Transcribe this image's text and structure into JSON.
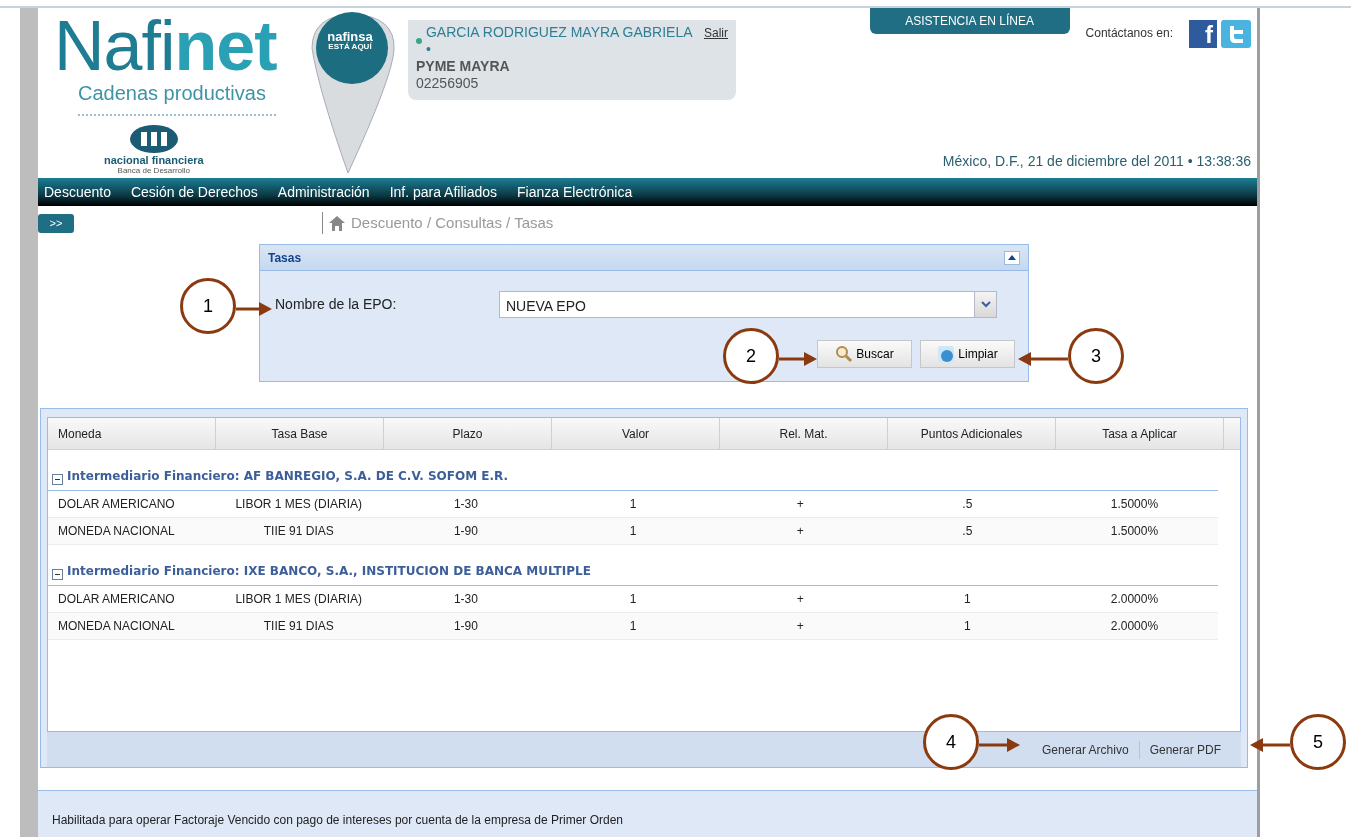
{
  "logo": {
    "wordmark": "Nafi**net**",
    "tagline": "Cadenas productivas",
    "institution": "nacional financiera",
    "institution_sub": "Banca de Desarrollo",
    "pin_line_1": "nafinsa",
    "pin_line_2": "ESTÁ AQUÍ"
  },
  "user": {
    "name": "GARCIA RODRIGUEZ MAYRA GABRIELA •",
    "logout": "Salir",
    "company": "PYME MAYRA",
    "number": "02256905"
  },
  "assist_button": "ASISTENCIA EN LÍNEA",
  "contact_label": "Contáctanos en:",
  "social": [
    {
      "kind": "facebook",
      "glyph": "f"
    },
    {
      "kind": "twitter"
    }
  ],
  "datetime": "México, D.F., 21 de diciembre del 2011 •  13:38:36",
  "menu": [
    "Descuento",
    "Cesión de Derechos",
    "Administración",
    "Inf. para Afiliados",
    "Fianza Electrónica"
  ],
  "sidebar_toggle": ">>",
  "breadcrumb": "Descuento / Consultas / Tasas",
  "filter_panel": {
    "title": "Tasas",
    "collapsed": false,
    "field_label": "Nombre de la EPO:",
    "field_value": "NUEVA EPO",
    "buttons": [
      {
        "kind": "search",
        "label": "Buscar"
      },
      {
        "kind": "clear",
        "label": "Limpiar"
      }
    ]
  },
  "grid": {
    "columns": [
      "Moneda",
      "Tasa Base",
      "Plazo",
      "Valor",
      "Rel. Mat.",
      "Puntos Adicionales",
      "Tasa a Aplicar"
    ],
    "groups": [
      {
        "title": "Intermediario Financiero: AF BANREGIO, S.A. DE C.V. SOFOM E.R.",
        "expanded": true,
        "rows": [
          [
            "DOLAR AMERICANO",
            "LIBOR 1 MES (DIARIA)",
            "1-30",
            "1",
            "+",
            ".5",
            "1.5000%"
          ],
          [
            "MONEDA NACIONAL",
            "TIIE 91 DIAS",
            "1-90",
            "1",
            "+",
            ".5",
            "1.5000%"
          ]
        ]
      },
      {
        "title": "Intermediario Financiero: IXE BANCO, S.A., INSTITUCION DE BANCA MULTIPLE",
        "expanded": true,
        "rows": [
          [
            "DOLAR AMERICANO",
            "LIBOR 1 MES (DIARIA)",
            "1-30",
            "1",
            "+",
            "1",
            "2.0000%"
          ],
          [
            "MONEDA NACIONAL",
            "TIIE 91 DIAS",
            "1-90",
            "1",
            "+",
            "1",
            "2.0000%"
          ]
        ]
      }
    ],
    "actions": [
      "Generar Archivo",
      "Generar PDF"
    ]
  },
  "note": "Habilitada para operar Factoraje Vencido con pago de intereses por cuenta de la empresa de Primer Orden",
  "callouts": [
    {
      "number": "1",
      "kind": "right"
    },
    {
      "number": "2",
      "kind": "right"
    },
    {
      "number": "3",
      "kind": "left"
    },
    {
      "number": "4",
      "kind": "right"
    },
    {
      "number": "5",
      "kind": "left"
    }
  ]
}
